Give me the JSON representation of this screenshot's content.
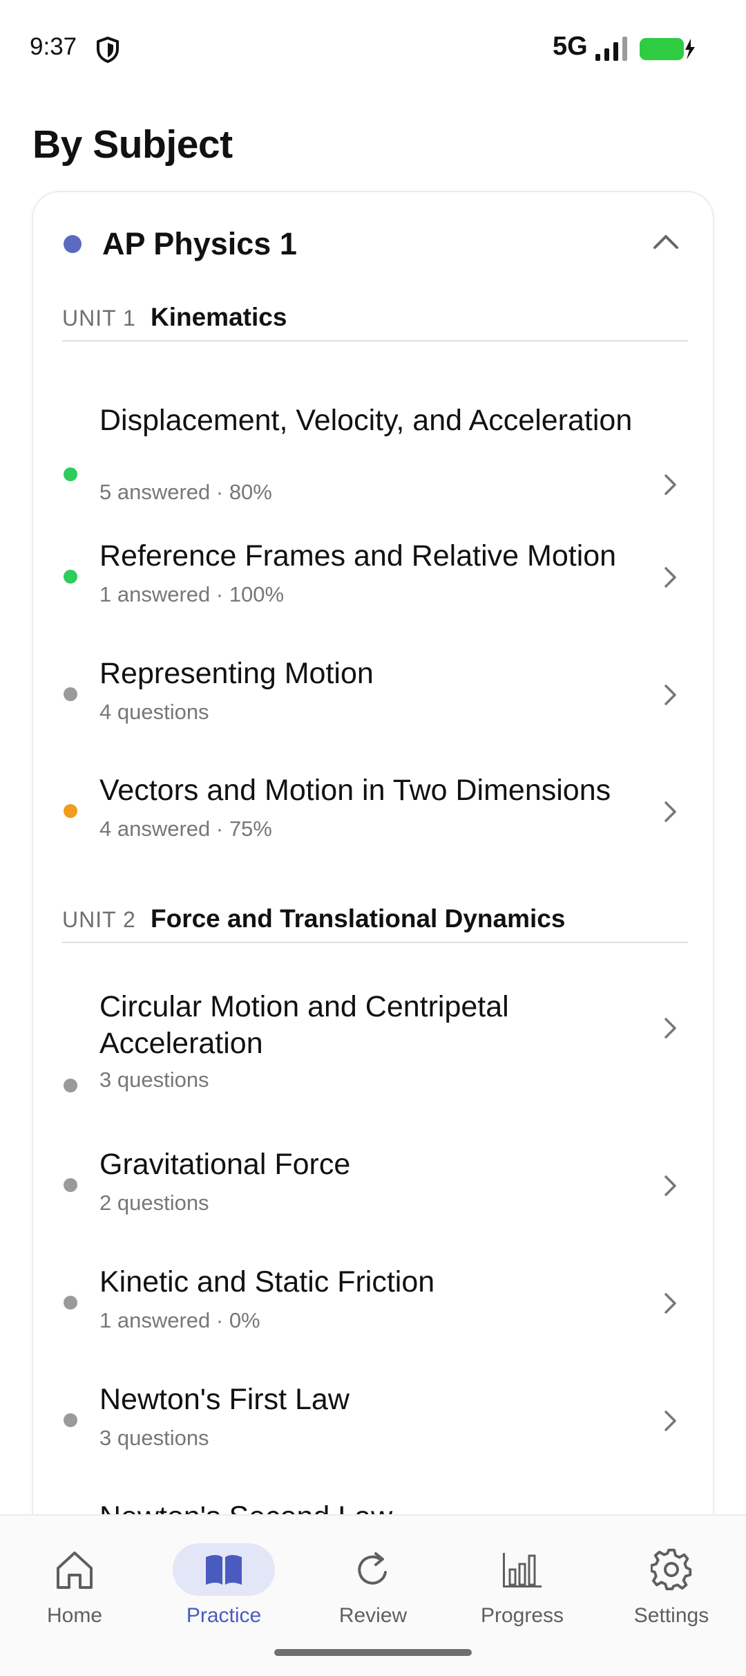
{
  "status_bar": {
    "time": "9:37",
    "network": "5G",
    "shield_icon": "shield-icon",
    "signal_icon": "signal-bars-icon",
    "battery_icon": "battery-charging-icon",
    "battery_color": "#2ecc40"
  },
  "page": {
    "title": "By Subject"
  },
  "subject": {
    "name": "AP Physics 1",
    "dot_color": "#5b6abf",
    "collapse_icon": "chevron-up-icon",
    "units": [
      {
        "tag": "UNIT 1",
        "name": "Kinematics",
        "topics": [
          {
            "title": "Displacement, Velocity, and Acceleration",
            "meta": "5 answered · 80%",
            "status_color": "#2ecc5b"
          },
          {
            "title": "Reference Frames and Relative Motion",
            "meta": "1 answered · 100%",
            "status_color": "#2ecc5b"
          },
          {
            "title": "Representing Motion",
            "meta": "4 questions",
            "status_color": "#9a9a9a"
          },
          {
            "title": "Vectors and Motion in Two Dimensions",
            "meta": "4 answered · 75%",
            "status_color": "#f29b1d"
          }
        ]
      },
      {
        "tag": "UNIT 2",
        "name": "Force and Translational Dynamics",
        "topics": [
          {
            "title": "Circular Motion and Centripetal Acceleration",
            "meta": "3 questions",
            "status_color": "#9a9a9a"
          },
          {
            "title": "Gravitational Force",
            "meta": "2 questions",
            "status_color": "#9a9a9a"
          },
          {
            "title": "Kinetic and Static Friction",
            "meta": "1 answered · 0%",
            "status_color": "#9a9a9a"
          },
          {
            "title": "Newton's First Law",
            "meta": "3 questions",
            "status_color": "#9a9a9a"
          },
          {
            "title": "Newton's Second Law",
            "meta": "",
            "status_color": "#9a9a9a"
          }
        ]
      }
    ]
  },
  "nav": {
    "active_color": "#4a5bbf",
    "items": [
      {
        "label": "Home",
        "icon": "home-icon",
        "active": false
      },
      {
        "label": "Practice",
        "icon": "book-icon",
        "active": true
      },
      {
        "label": "Review",
        "icon": "refresh-icon",
        "active": false
      },
      {
        "label": "Progress",
        "icon": "bar-chart-icon",
        "active": false
      },
      {
        "label": "Settings",
        "icon": "gear-icon",
        "active": false
      }
    ]
  }
}
